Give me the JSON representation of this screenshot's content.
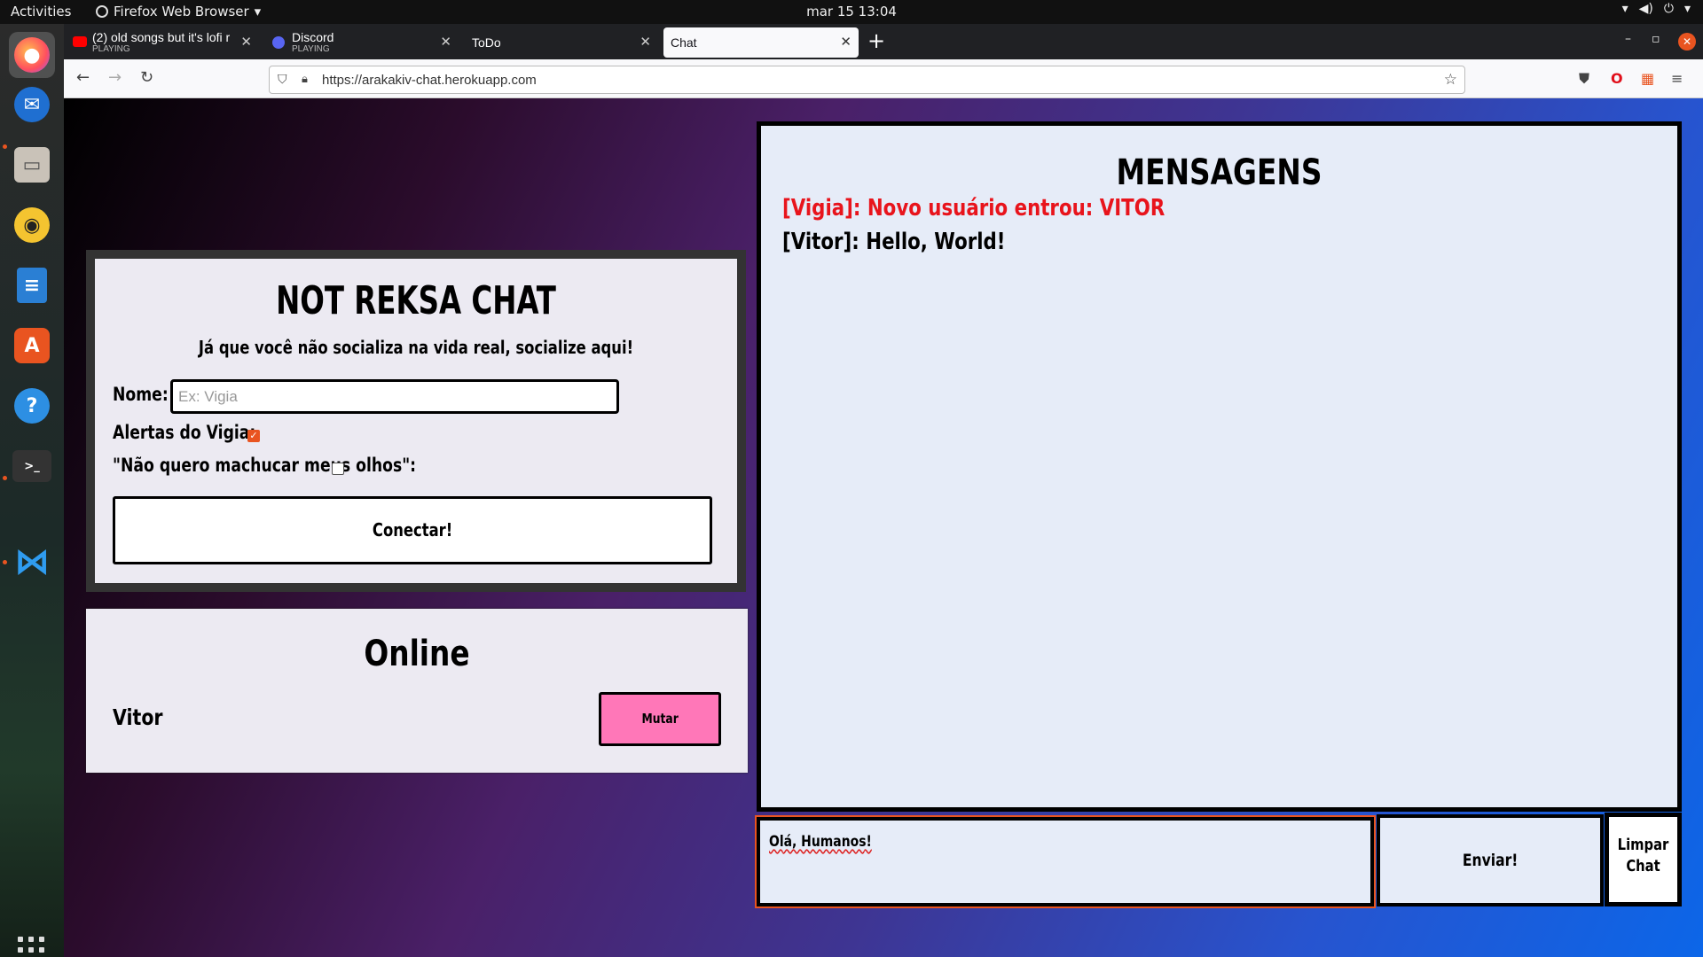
{
  "topbar": {
    "activities": "Activities",
    "app_name": "Firefox Web Browser",
    "clock": "mar 15  13:04"
  },
  "dock": {
    "items": [
      {
        "icon": "firefox-icon",
        "active": true
      },
      {
        "icon": "thunderbird-icon"
      },
      {
        "icon": "files-icon"
      },
      {
        "icon": "rhythmbox-icon"
      },
      {
        "icon": "writer-icon"
      },
      {
        "icon": "software-store-icon"
      },
      {
        "icon": "help-icon"
      },
      {
        "icon": "terminal-icon"
      },
      {
        "icon": "vscode-icon"
      }
    ]
  },
  "browser": {
    "tabs": [
      {
        "title": "(2) old songs but it's lofi r",
        "subtitle": "PLAYING",
        "favicon_color": "#ff0000"
      },
      {
        "title": "Discord",
        "subtitle": "PLAYING",
        "favicon_color": "#5865f2"
      },
      {
        "title": "ToDo",
        "subtitle": ""
      },
      {
        "title": "Chat",
        "subtitle": "",
        "selected": true
      }
    ],
    "new_tab": "+",
    "url": "https://arakakiv-chat.herokuapp.com"
  },
  "login": {
    "title": "NOT REKSA CHAT",
    "subtitle": "Já que você não socializa na vida real, socialize aqui!",
    "name_label": "Nome:",
    "name_placeholder": "Ex: Vigia",
    "alerts_label": "Alertas do Vigia:",
    "alerts_checked": true,
    "eyes_label": "\"Não quero machucar meus olhos\":",
    "eyes_checked": false,
    "connect_label": "Conectar!"
  },
  "online": {
    "title": "Online",
    "users": [
      {
        "name": "Vitor",
        "mute_label": "Mutar"
      }
    ]
  },
  "messages": {
    "title": "MENSAGENS",
    "items": [
      {
        "text": "[Vigia]: Novo usuário entrou: VITOR",
        "color": "#e8141c"
      },
      {
        "text": "[Vitor]: Hello, World!",
        "color": "#000000"
      }
    ]
  },
  "composer": {
    "value": "Olá, Humanos!",
    "send_label": "Enviar!",
    "clear_label_1": "Limpar",
    "clear_label_2": "Chat"
  },
  "colors": {
    "accent": "#e95420",
    "mute_button": "#ff77b8",
    "vigia_message": "#e8141c"
  }
}
